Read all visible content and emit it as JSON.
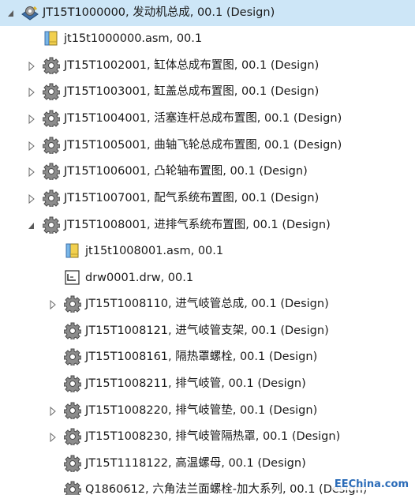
{
  "tree": {
    "items": [
      {
        "label": "JT15T1000000, 发动机总成, 00.1 (Design)",
        "icon": "assembly-root-icon",
        "expander": "expanded"
      },
      {
        "label": "jt15t1000000.asm, 00.1",
        "icon": "asm-file-icon",
        "expander": "none"
      },
      {
        "label": "JT15T1002001, 缸体总成布置图, 00.1 (Design)",
        "icon": "gear-icon",
        "expander": "collapsed"
      },
      {
        "label": "JT15T1003001, 缸盖总成布置图, 00.1 (Design)",
        "icon": "gear-icon",
        "expander": "collapsed"
      },
      {
        "label": "JT15T1004001, 活塞连杆总成布置图, 00.1 (Design)",
        "icon": "gear-icon",
        "expander": "collapsed"
      },
      {
        "label": "JT15T1005001, 曲轴飞轮总成布置图, 00.1 (Design)",
        "icon": "gear-icon",
        "expander": "collapsed"
      },
      {
        "label": "JT15T1006001, 凸轮轴布置图, 00.1 (Design)",
        "icon": "gear-icon",
        "expander": "collapsed"
      },
      {
        "label": "JT15T1007001, 配气系统布置图, 00.1 (Design)",
        "icon": "gear-icon",
        "expander": "collapsed"
      },
      {
        "label": "JT15T1008001, 进排气系统布置图, 00.1 (Design)",
        "icon": "gear-icon",
        "expander": "expanded"
      },
      {
        "label": "jt15t1008001.asm, 00.1",
        "icon": "asm-file-icon",
        "expander": "none"
      },
      {
        "label": "drw0001.drw, 00.1",
        "icon": "drawing-file-icon",
        "expander": "none"
      },
      {
        "label": "JT15T1008110, 进气岐管总成, 00.1 (Design)",
        "icon": "gear-icon",
        "expander": "collapsed"
      },
      {
        "label": "JT15T1008121, 进气岐管支架, 00.1 (Design)",
        "icon": "gear-icon",
        "expander": "none"
      },
      {
        "label": "JT15T1008161, 隔热罩螺栓, 00.1 (Design)",
        "icon": "gear-icon",
        "expander": "none"
      },
      {
        "label": "JT15T1008211, 排气岐管, 00.1 (Design)",
        "icon": "gear-icon",
        "expander": "none"
      },
      {
        "label": "JT15T1008220, 排气岐管垫, 00.1 (Design)",
        "icon": "gear-icon",
        "expander": "collapsed"
      },
      {
        "label": "JT15T1008230, 排气岐管隔热罩, 00.1 (Design)",
        "icon": "gear-icon",
        "expander": "collapsed"
      },
      {
        "label": "JT15T1118122, 高温螺母, 00.1 (Design)",
        "icon": "gear-icon",
        "expander": "none"
      },
      {
        "label": "Q1860612, 六角法兰面螺栓-加大系列, 00.1 (Design)",
        "icon": "gear-icon",
        "expander": "none"
      }
    ]
  },
  "watermark": "EEChina.com",
  "colors": {
    "selection": "#cde6f7",
    "gear_fill": "#8c8c8c",
    "asm_fill": "#f2d04e"
  }
}
